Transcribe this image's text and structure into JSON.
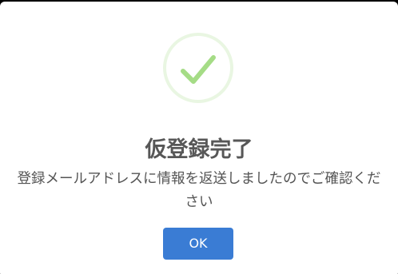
{
  "dialog": {
    "icon": "success-check-icon",
    "title": "仮登録完了",
    "message": "登録メールアドレスに情報を返送しましたのでご確認ください",
    "ok_label": "OK"
  },
  "colors": {
    "check": "#a5dc86",
    "ring": "#e9f6e2",
    "button": "#3a7cd4",
    "title": "#575757",
    "text": "#545454"
  }
}
